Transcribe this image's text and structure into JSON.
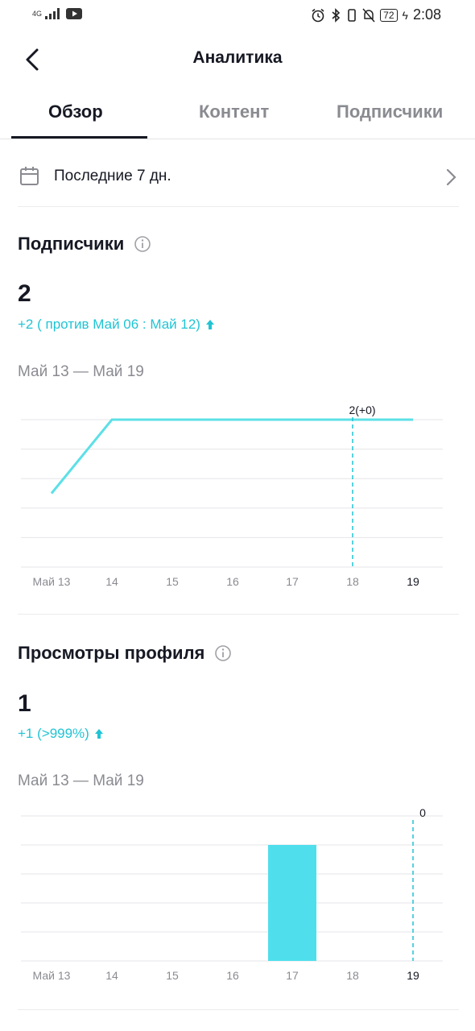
{
  "status_bar": {
    "network": "4G",
    "battery": "72",
    "time": "2:08"
  },
  "header": {
    "title": "Аналитика"
  },
  "tabs": [
    {
      "label": "Обзор",
      "active": true
    },
    {
      "label": "Контент",
      "active": false
    },
    {
      "label": "Подписчики",
      "active": false
    }
  ],
  "date_filter": {
    "label": "Последние 7 дн."
  },
  "followers": {
    "title": "Подписчики",
    "value": "2",
    "delta": "+2 ( против Май 06 : Май 12)",
    "range": "Май 13 — Май 19",
    "marker_label": "2(+0)"
  },
  "profile_views": {
    "title": "Просмотры профиля",
    "value": "1",
    "delta": "+1 (>999%)",
    "range": "Май 13 — Май 19",
    "marker_label": "0"
  },
  "colors": {
    "accent": "#20c4d4",
    "line": "#5ce0e6",
    "bar": "#4fdfec",
    "text": "#161823",
    "muted": "#8a8b91"
  },
  "chart_data": [
    {
      "type": "line",
      "categories": [
        "Май 13",
        "14",
        "15",
        "16",
        "17",
        "18",
        "19"
      ],
      "values": [
        1,
        2,
        2,
        2,
        2,
        2,
        2
      ],
      "marker_category": "18",
      "ylim": [
        0,
        2
      ],
      "grid": true
    },
    {
      "type": "bar",
      "categories": [
        "Май 13",
        "14",
        "15",
        "16",
        "17",
        "18",
        "19"
      ],
      "values": [
        0,
        0,
        0,
        0,
        1,
        0,
        0
      ],
      "marker_category": "19",
      "ylim": [
        0,
        1.25
      ],
      "grid": true
    }
  ]
}
